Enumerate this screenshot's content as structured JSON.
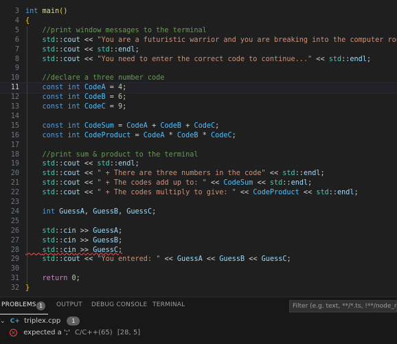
{
  "editor": {
    "current_line": 11,
    "lines": [
      {
        "n": "3",
        "t": "int main()"
      },
      {
        "n": "4",
        "t": "{"
      },
      {
        "n": "5",
        "t": "    //print window messages to the terminal"
      },
      {
        "n": "6",
        "t": "    std::cout << \"You are a futuristic warrior and you are breaking into the computer room\";"
      },
      {
        "n": "7",
        "t": "    std::cout << std::endl;"
      },
      {
        "n": "8",
        "t": "    std::cout << \"You need to enter the correct code to continue...\" << std::endl;"
      },
      {
        "n": "9",
        "t": ""
      },
      {
        "n": "10",
        "t": "    //declare a three number code"
      },
      {
        "n": "11",
        "t": "    const int CodeA = 4;"
      },
      {
        "n": "12",
        "t": "    const int CodeB = 6;"
      },
      {
        "n": "13",
        "t": "    const int CodeC = 9;"
      },
      {
        "n": "14",
        "t": ""
      },
      {
        "n": "15",
        "t": "    const int CodeSum = CodeA + CodeB + CodeC;"
      },
      {
        "n": "16",
        "t": "    const int CodeProduct = CodeA * CodeB * CodeC;"
      },
      {
        "n": "17",
        "t": ""
      },
      {
        "n": "18",
        "t": "    //print sum & product to the terminal"
      },
      {
        "n": "19",
        "t": "    std::cout << std::endl;"
      },
      {
        "n": "20",
        "t": "    std::cout << \" + There are three numbers in the code\" << std::endl;"
      },
      {
        "n": "21",
        "t": "    std::cout << \" + The codes add up to: \" << CodeSum << std::endl;"
      },
      {
        "n": "22",
        "t": "    std::cout << \" + The codes multiply to give: \" << CodeProduct << std::endl;"
      },
      {
        "n": "23",
        "t": ""
      },
      {
        "n": "24",
        "t": "    int GuessA, GuessB, GuessC;"
      },
      {
        "n": "25",
        "t": ""
      },
      {
        "n": "26",
        "t": "    std::cin >> GuessA;"
      },
      {
        "n": "27",
        "t": "    std::cin >> GuessB;"
      },
      {
        "n": "28",
        "t": "    std::cin >> GuessC;"
      },
      {
        "n": "29",
        "t": "    std::cout << \"You entered: \" << GuessA << GuessB << GuessC;"
      },
      {
        "n": "30",
        "t": ""
      },
      {
        "n": "31",
        "t": "    return 0;"
      },
      {
        "n": "32",
        "t": "}"
      }
    ]
  },
  "panel": {
    "tabs": [
      {
        "label": "PROBLEMS",
        "badge": "1"
      },
      {
        "label": "OUTPUT"
      },
      {
        "label": "DEBUG CONSOLE"
      },
      {
        "label": "TERMINAL"
      }
    ],
    "filter_placeholder": "Filter (e.g. text, **/*.ts, !**/node_modules/**)",
    "file": {
      "name": "triplex.cpp",
      "count": "1",
      "icon": "C"
    },
    "problem": {
      "message": "expected a ';'",
      "source": "C/C++(65)",
      "location": "[28, 5]"
    }
  },
  "colors": {
    "background": "#1f1f1f",
    "keyword": "#569cd6",
    "string": "#ce9178",
    "comment": "#6a9955",
    "error": "#f14c4c"
  }
}
